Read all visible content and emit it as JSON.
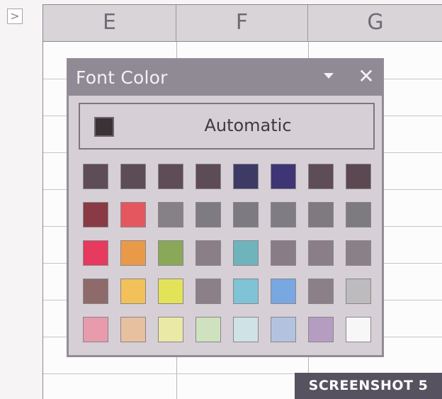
{
  "expand_button": {
    "glyph": ">"
  },
  "sheet": {
    "columns": [
      "E",
      "F",
      "G"
    ]
  },
  "font_color_palette": {
    "title": "Font Color",
    "dropdown_glyph": "▼",
    "close_glyph": "✕",
    "automatic": {
      "label": "Automatic",
      "color": "#3a3236"
    },
    "swatches": [
      [
        "#5e4d55",
        "#5b4c55",
        "#5e4c56",
        "#5d4c55",
        "#3e3a66",
        "#3e3574",
        "#5e4c56",
        "#5b4851"
      ],
      [
        "#8a3a44",
        "#e5575e",
        "#858186",
        "#7f7b82",
        "#7e7a82",
        "#807c84",
        "#7e7a80",
        "#7e7b80"
      ],
      [
        "#e63a5e",
        "#e99a48",
        "#8aa857",
        "#8a7f86",
        "#6fb4bd",
        "#887c86",
        "#8a7e88",
        "#8a8088"
      ],
      [
        "#8e6a6a",
        "#f2c15a",
        "#e3e359",
        "#8c8088",
        "#7fc3d6",
        "#79a7e0",
        "#8c8088",
        "#bdbbbd"
      ],
      [
        "#e79bac",
        "#e7c0a0",
        "#ebe9a6",
        "#cfe2bf",
        "#cfe2e6",
        "#b3c3df",
        "#b59dc1",
        "#f7f7f7"
      ]
    ]
  },
  "watermark": {
    "text": "SCREENSHOT 5"
  }
}
